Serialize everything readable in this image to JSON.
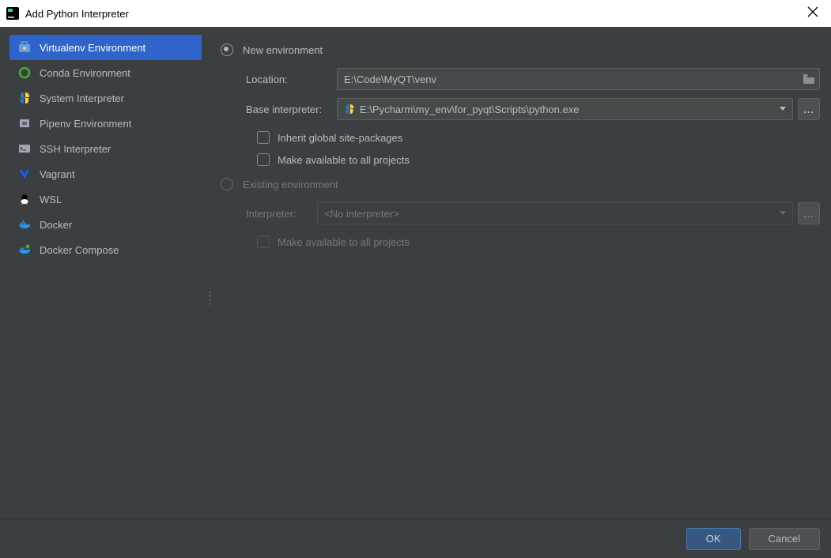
{
  "window": {
    "title": "Add Python Interpreter"
  },
  "sidebar": {
    "items": [
      {
        "label": "Virtualenv Environment"
      },
      {
        "label": "Conda Environment"
      },
      {
        "label": "System Interpreter"
      },
      {
        "label": "Pipenv Environment"
      },
      {
        "label": "SSH Interpreter"
      },
      {
        "label": "Vagrant"
      },
      {
        "label": "WSL"
      },
      {
        "label": "Docker"
      },
      {
        "label": "Docker Compose"
      }
    ]
  },
  "newEnv": {
    "radioLabel": "New environment",
    "locationLabel": "Location:",
    "locationValue": "E:\\Code\\MyQT\\venv",
    "baseLabel": "Base interpreter:",
    "baseValue": "E:\\Pycharm\\my_env\\for_pyqt\\Scripts\\python.exe",
    "inheritLabel": "Inherit global site-packages",
    "availableLabel": "Make available to all projects"
  },
  "existingEnv": {
    "radioLabel": "Existing environment",
    "interpreterLabel": "Interpreter:",
    "interpreterValue": "<No interpreter>",
    "availableLabel": "Make available to all projects"
  },
  "buttons": {
    "ok": "OK",
    "cancel": "Cancel",
    "ellipsis": "..."
  }
}
